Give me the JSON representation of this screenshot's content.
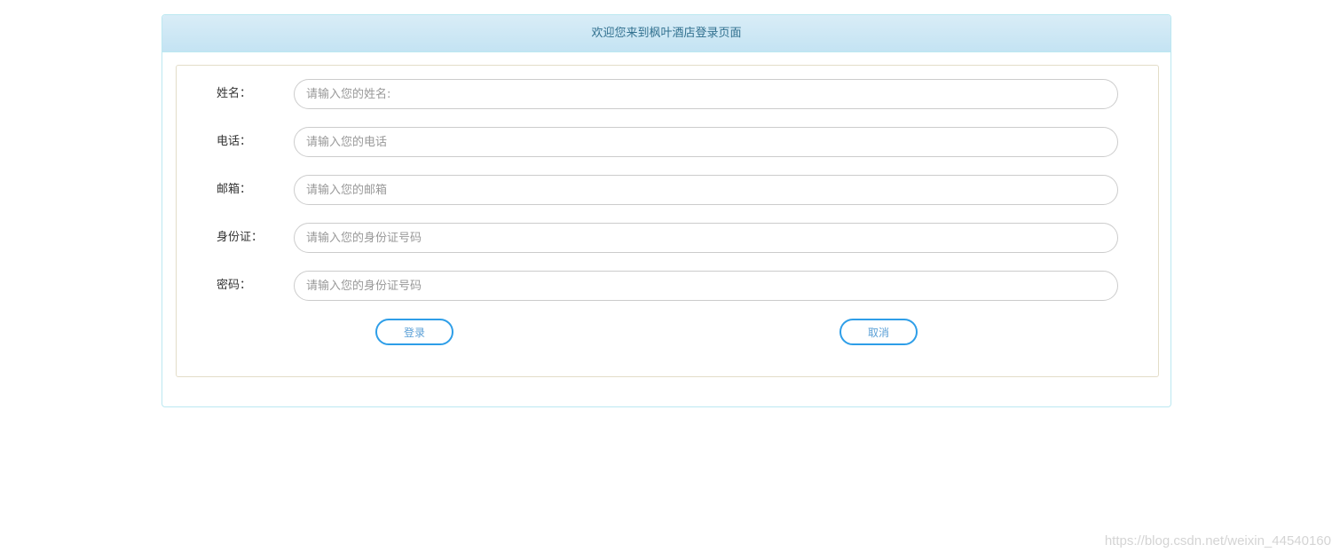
{
  "header": {
    "title": "欢迎您来到枫叶酒店登录页面"
  },
  "form": {
    "fields": [
      {
        "label": "姓名：",
        "placeholder": "请输入您的姓名:"
      },
      {
        "label": "电话：",
        "placeholder": "请输入您的电话"
      },
      {
        "label": "邮箱：",
        "placeholder": "请输入您的邮箱"
      },
      {
        "label": "身份证：",
        "placeholder": "请输入您的身份证号码"
      },
      {
        "label": "密码：",
        "placeholder": "请输入您的身份证号码"
      }
    ],
    "login_label": "登录",
    "cancel_label": "取消"
  },
  "watermark": "https://blog.csdn.net/weixin_44540160",
  "colors": {
    "header_bg": "#d9edf7",
    "header_text": "#31708f",
    "button_border": "#2e9ee8"
  }
}
